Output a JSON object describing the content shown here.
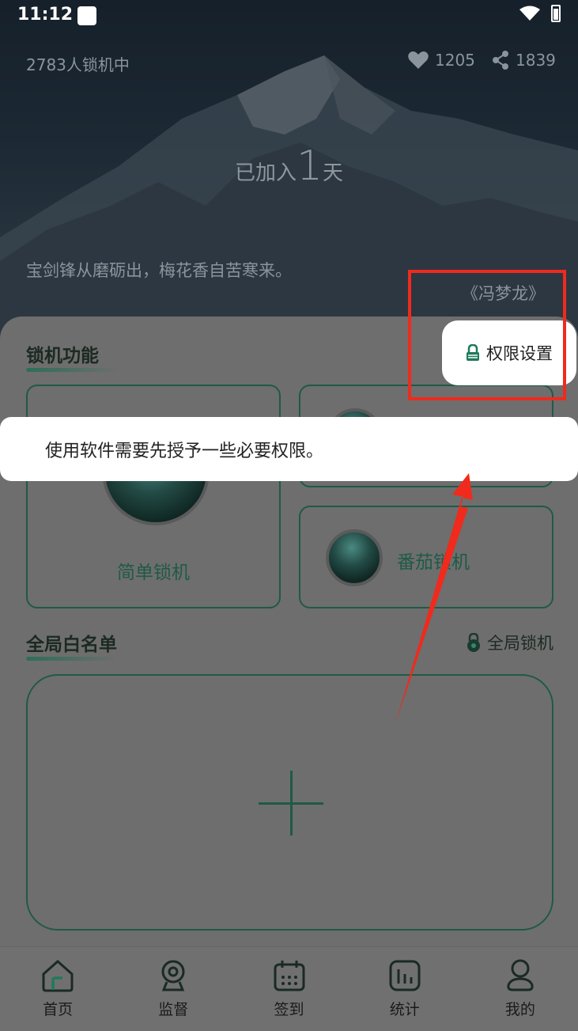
{
  "status_bar": {
    "time": "11:12"
  },
  "header": {
    "lock_count": "2783人锁机中",
    "likes": "1205",
    "shares": "1839",
    "joined_prefix": "已加入",
    "joined_days": "1",
    "joined_suffix": "天",
    "quote": "宝剑锋从磨砺出，梅花香自苦寒来。",
    "quote_author": "《冯梦龙》"
  },
  "lock_section": {
    "title": "锁机功能",
    "permission_button": "权限设置",
    "cards": [
      {
        "label": "简单锁机"
      },
      {
        "label": "番茄锁机"
      }
    ]
  },
  "tip": {
    "text": "使用软件需要先授予一些必要权限。"
  },
  "whitelist_section": {
    "title": "全局白名单",
    "global_lock_label": "全局锁机"
  },
  "bottom_nav": {
    "items": [
      {
        "label": "首页",
        "icon": "home-icon"
      },
      {
        "label": "监督",
        "icon": "camera-icon"
      },
      {
        "label": "签到",
        "icon": "calendar-icon"
      },
      {
        "label": "统计",
        "icon": "chart-icon"
      },
      {
        "label": "我的",
        "icon": "person-icon"
      }
    ]
  },
  "colors": {
    "accent": "#1f5a46",
    "highlight_red": "#f02a1c",
    "overlay_gray": "#6e6e6e"
  }
}
